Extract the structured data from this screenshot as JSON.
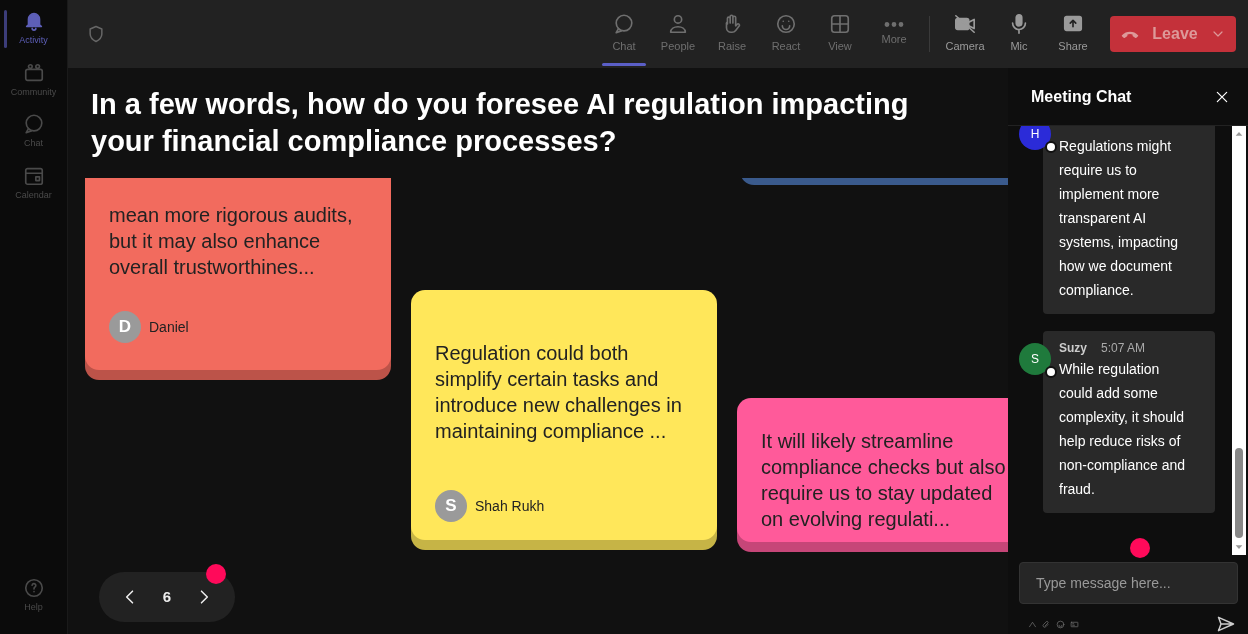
{
  "rail": {
    "items": [
      {
        "label": "Activity",
        "selected": true
      },
      {
        "label": "Community",
        "selected": false
      },
      {
        "label": "Chat",
        "selected": false
      },
      {
        "label": "Calendar",
        "selected": false
      }
    ],
    "help": {
      "label": "Help"
    }
  },
  "toolbar": {
    "items": [
      {
        "label": "Chat",
        "selected": true
      },
      {
        "label": "People",
        "selected": false
      },
      {
        "label": "Raise",
        "selected": false
      },
      {
        "label": "React",
        "selected": false
      },
      {
        "label": "View",
        "selected": false
      },
      {
        "label": "More",
        "selected": false
      }
    ],
    "media": [
      {
        "label": "Camera"
      },
      {
        "label": "Mic"
      },
      {
        "label": "Share"
      }
    ],
    "leave_button": {
      "label": "Leave"
    }
  },
  "question": "In a few words, how do you foresee AI regulation impacting your financial compliance processes?",
  "notes": [
    {
      "text": "mean more rigorous audits, but it may also enhance overall trustworthines...",
      "author": "Daniel",
      "initial": "D",
      "color": "#f26b5e"
    },
    {
      "text": "Regulation could both simplify certain tasks and introduce new challenges in maintaining compliance ...",
      "author": "Shah Rukh",
      "initial": "S",
      "color": "#ffe75a"
    },
    {
      "text": "It will likely streamline compliance checks but also require us to stay updated on evolving regulati...",
      "color": "#ff5a9a"
    },
    {
      "color": "#3a5a8c"
    }
  ],
  "pager": {
    "page": "6"
  },
  "chat": {
    "title": "Meeting Chat",
    "messages": [
      {
        "initial": "H",
        "color": "#2b2bd8",
        "text": "Regulations might require us to implement more transparent AI systems, impacting how we document compliance."
      },
      {
        "initial": "S",
        "color": "#1f7a3c",
        "author": "Suzy",
        "time": "5:07 AM",
        "text": "While regulation could add some complexity, it should help reduce risks of non-compliance and fraud."
      }
    ],
    "placeholder": "Type message here..."
  }
}
